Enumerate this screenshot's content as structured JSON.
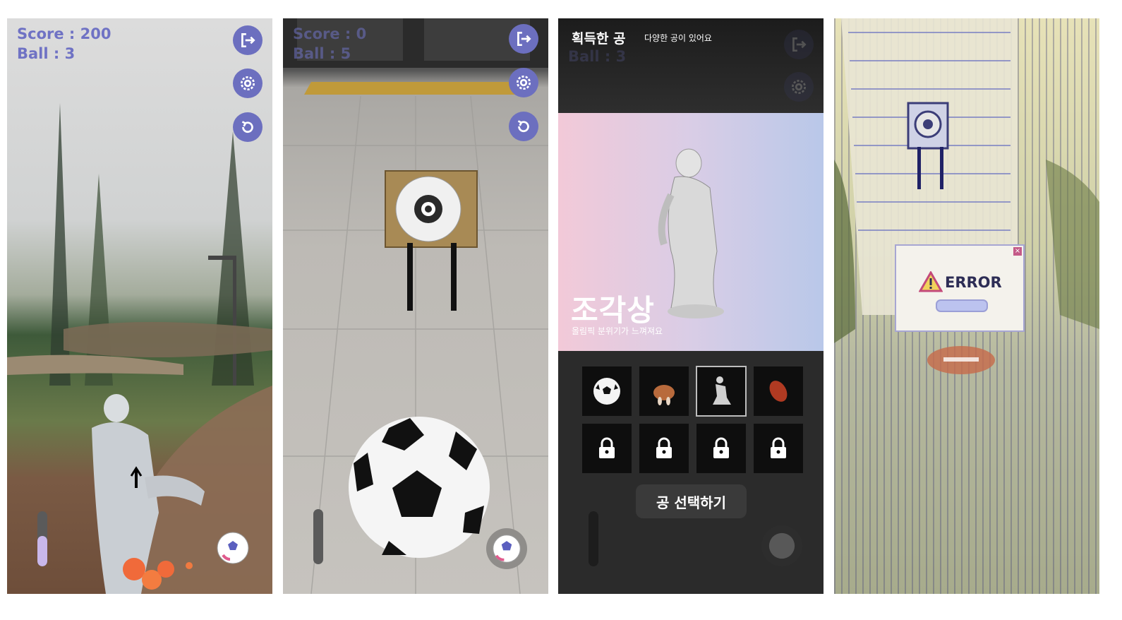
{
  "screens": [
    {
      "hud": {
        "score": "Score : 200",
        "ball": "Ball : 3"
      },
      "power_level": 0.55
    },
    {
      "hud": {
        "score": "Score : 0",
        "ball": "Ball : 5"
      },
      "power_level": 0.0
    },
    {
      "header": {
        "title": "획득한 공",
        "subtitle": "다양한 공이 있어요"
      },
      "hud": {
        "ball": "Ball : 3"
      },
      "featured": {
        "name": "조각상",
        "description": "올림픽 분위기가 느껴져요"
      },
      "balls": [
        {
          "icon": "soccer-ball-icon",
          "locked": false
        },
        {
          "icon": "roast-chicken-icon",
          "locked": false
        },
        {
          "icon": "statue-icon",
          "locked": false,
          "selected": true
        },
        {
          "icon": "rugby-ball-icon",
          "locked": false
        },
        {
          "icon": "lock-icon",
          "locked": true
        },
        {
          "icon": "lock-icon",
          "locked": true
        },
        {
          "icon": "lock-icon",
          "locked": true
        },
        {
          "icon": "lock-icon",
          "locked": true
        }
      ],
      "select_button": "공 선택하기"
    },
    {
      "error_popup": {
        "text": "ERROR"
      }
    }
  ],
  "colors": {
    "accent": "#6c6fbf",
    "hud_text": "#6f72c4"
  },
  "icons": {
    "exit": "exit-icon",
    "settings": "gear-icon",
    "reset": "reset-icon"
  }
}
